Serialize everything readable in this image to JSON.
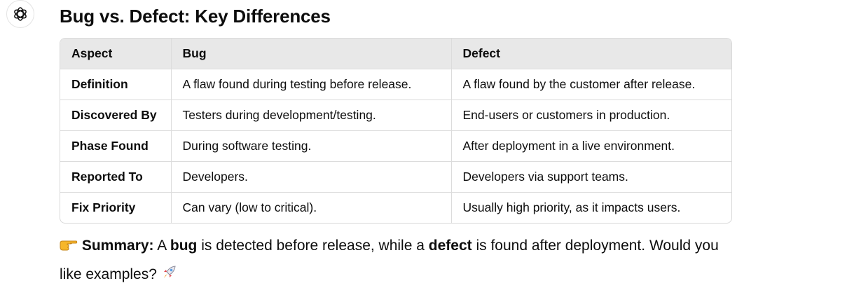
{
  "title": "Bug vs. Defect: Key Differences",
  "table": {
    "headers": [
      "Aspect",
      "Bug",
      "Defect"
    ],
    "rows": [
      [
        "Definition",
        "A flaw found during testing before release.",
        "A flaw found by the customer after release."
      ],
      [
        "Discovered By",
        "Testers during development/testing.",
        "End-users or customers in production."
      ],
      [
        "Phase Found",
        "During software testing.",
        "After deployment in a live environment."
      ],
      [
        "Reported To",
        "Developers.",
        "Developers via support teams."
      ],
      [
        "Fix Priority",
        "Can vary (low to critical).",
        "Usually high priority, as it impacts users."
      ]
    ]
  },
  "summary": {
    "emoji_lead": "pointing-hand-icon",
    "label": "Summary:",
    "t1": " A ",
    "bug": "bug",
    "t2": " is detected before release, while a ",
    "defect": "defect",
    "t3": " is found after deployment. Would you like examples?",
    "emoji_trail": "rocket-icon"
  },
  "colors": {
    "header_bg": "#e8e8e8",
    "border": "#dcdcdc",
    "text": "#0d0d0d"
  }
}
